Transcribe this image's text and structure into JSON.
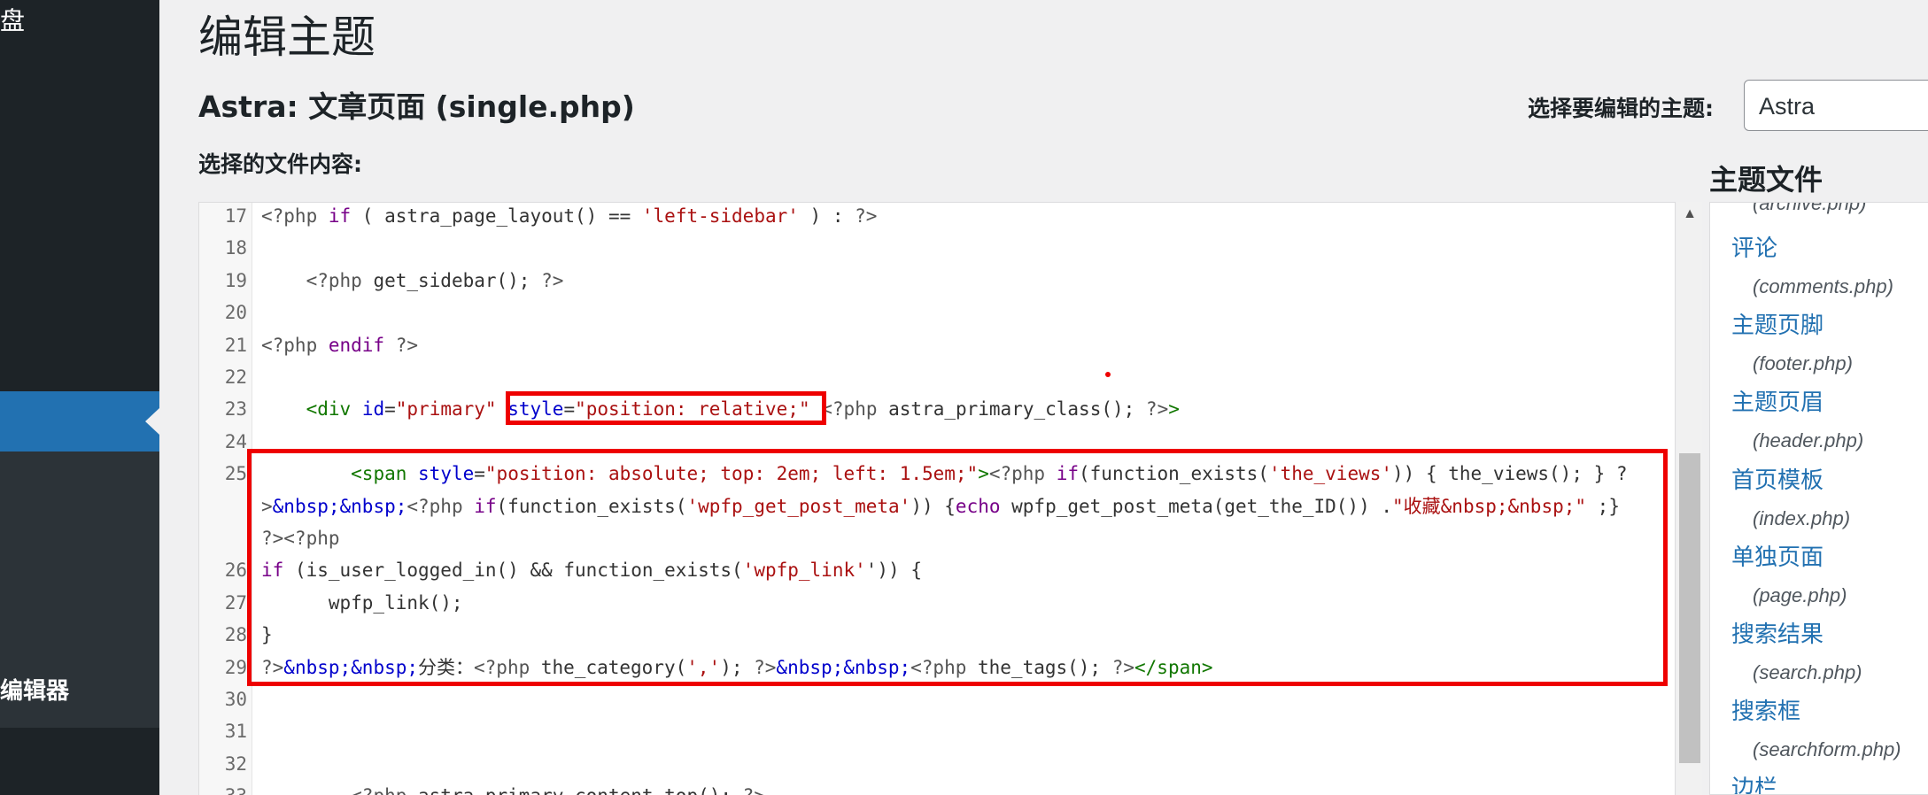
{
  "admin_menu": {
    "top_fragment": "盘",
    "bottom_fragment": "编辑器"
  },
  "page": {
    "title": "编辑主题",
    "file_heading_theme": "Astra: ",
    "file_heading_name": "文章页面",
    "file_heading_file": " (single.php)",
    "content_label": "选择的文件内容:",
    "theme_select_label": "选择要编辑的主题:",
    "theme_select_value": "Astra"
  },
  "editor": {
    "lines": [
      {
        "n": "17",
        "tokens": [
          [
            "php",
            "<?php "
          ],
          [
            "kw",
            "if"
          ],
          [
            "def",
            " ( astra_page_layout() == "
          ],
          [
            "str",
            "'left-sidebar'"
          ],
          [
            "def",
            " ) : "
          ],
          [
            "php",
            "?>"
          ]
        ]
      },
      {
        "n": "18",
        "tokens": []
      },
      {
        "n": "19",
        "tokens": [
          [
            "def",
            "    "
          ],
          [
            "php",
            "<?php "
          ],
          [
            "def",
            "get_sidebar(); "
          ],
          [
            "php",
            "?>"
          ]
        ]
      },
      {
        "n": "20",
        "tokens": []
      },
      {
        "n": "21",
        "tokens": [
          [
            "php",
            "<?php "
          ],
          [
            "kw",
            "endif"
          ],
          [
            "def",
            " "
          ],
          [
            "php",
            "?>"
          ]
        ]
      },
      {
        "n": "22",
        "tokens": []
      },
      {
        "n": "23",
        "tokens": [
          [
            "def",
            "    "
          ],
          [
            "tag",
            "<div"
          ],
          [
            "def",
            " "
          ],
          [
            "attr",
            "id"
          ],
          [
            "def",
            "="
          ],
          [
            "str",
            "\"primary\""
          ],
          [
            "def",
            " "
          ],
          [
            "attr",
            "style"
          ],
          [
            "def",
            "="
          ],
          [
            "str",
            "\"position: relative;\""
          ],
          [
            "def",
            " "
          ],
          [
            "php",
            "<?php "
          ],
          [
            "def",
            "astra_primary_class(); "
          ],
          [
            "php",
            "?>"
          ],
          [
            "tag",
            ">"
          ]
        ]
      },
      {
        "n": "24",
        "tokens": []
      },
      {
        "n": "25",
        "tokens": [
          [
            "def",
            "        "
          ],
          [
            "tag",
            "<span"
          ],
          [
            "def",
            " "
          ],
          [
            "attr",
            "style"
          ],
          [
            "def",
            "="
          ],
          [
            "str",
            "\"position: absolute; top: 2em; left: 1.5em;\""
          ],
          [
            "tag",
            ">"
          ],
          [
            "php",
            "<?php "
          ],
          [
            "kw",
            "if"
          ],
          [
            "def",
            "(function_exists("
          ],
          [
            "str",
            "'the_views'"
          ],
          [
            "def",
            ")) { the_views(); } ?"
          ]
        ]
      },
      {
        "n": "",
        "tokens": [
          [
            "php",
            ">"
          ],
          [
            "attr",
            "&nbsp;&nbsp;"
          ],
          [
            "php",
            "<?php "
          ],
          [
            "kw",
            "if"
          ],
          [
            "def",
            "(function_exists("
          ],
          [
            "str",
            "'wpfp_get_post_meta'"
          ],
          [
            "def",
            ")) {"
          ],
          [
            "kw",
            "echo"
          ],
          [
            "def",
            " wpfp_get_post_meta(get_the_ID()) ."
          ],
          [
            "str",
            "\"收藏&nbsp;&nbsp;\""
          ],
          [
            "def",
            " ;}"
          ]
        ]
      },
      {
        "n": "",
        "tokens": [
          [
            "php",
            "?><?php"
          ]
        ]
      },
      {
        "n": "26",
        "tokens": [
          [
            "kw",
            "if"
          ],
          [
            "def",
            " (is_user_logged_in() && function_exists("
          ],
          [
            "str",
            "'wpfp_link'"
          ],
          [
            "def",
            "')) {"
          ]
        ]
      },
      {
        "n": "27",
        "tokens": [
          [
            "def",
            "      wpfp_link();"
          ]
        ]
      },
      {
        "n": "28",
        "tokens": [
          [
            "def",
            "}"
          ]
        ]
      },
      {
        "n": "29",
        "tokens": [
          [
            "php",
            "?>"
          ],
          [
            "attr",
            "&nbsp;&nbsp;"
          ],
          [
            "def",
            "分类："
          ],
          [
            "php",
            "<?php "
          ],
          [
            "def",
            "the_category("
          ],
          [
            "str",
            "','"
          ],
          [
            "def",
            "); "
          ],
          [
            "php",
            "?>"
          ],
          [
            "attr",
            "&nbsp;&nbsp;"
          ],
          [
            "php",
            "<?php "
          ],
          [
            "def",
            "the_tags(); "
          ],
          [
            "php",
            "?>"
          ],
          [
            "tag",
            "</span>"
          ]
        ]
      },
      {
        "n": "30",
        "tokens": []
      },
      {
        "n": "31",
        "tokens": []
      },
      {
        "n": "32",
        "tokens": []
      },
      {
        "n": "33",
        "tokens": [
          [
            "def",
            "        "
          ],
          [
            "php",
            "<?php "
          ],
          [
            "def",
            "astra_primary_content_top(); "
          ],
          [
            "php",
            "?>"
          ]
        ]
      }
    ]
  },
  "scrollbar": {
    "up_arrow": "▲"
  },
  "theme_files": {
    "title": "主题文件",
    "cut_file": "(archive.php)",
    "items": [
      {
        "label": "评论",
        "file": "(comments.php)"
      },
      {
        "label": "主题页脚",
        "file": "(footer.php)"
      },
      {
        "label": "主题页眉",
        "file": "(header.php)"
      },
      {
        "label": "首页模板",
        "file": "(index.php)"
      },
      {
        "label": "单独页面",
        "file": "(page.php)"
      },
      {
        "label": "搜索结果",
        "file": "(search.php)"
      },
      {
        "label": "搜索框",
        "file": "(searchform.php)"
      },
      {
        "label": "边栏",
        "file": ""
      }
    ]
  },
  "colors": {
    "admin_bg": "#1d2327",
    "active_menu": "#2271b1",
    "annotation_red": "#ee0000"
  }
}
